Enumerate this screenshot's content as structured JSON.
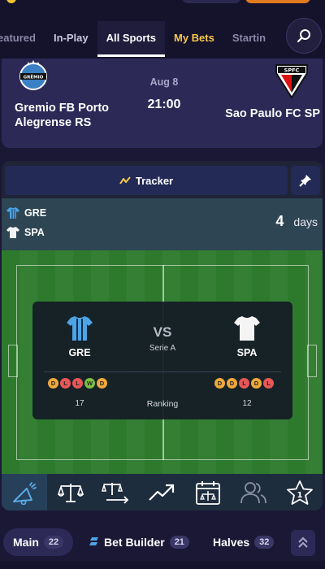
{
  "nav": {
    "tabs": [
      {
        "label": "eatured"
      },
      {
        "label": "In-Play"
      },
      {
        "label": "All Sports"
      },
      {
        "label": "My Bets"
      },
      {
        "label": "Startin"
      }
    ]
  },
  "match": {
    "home_team": "Gremio FB Porto Alegrense RS",
    "away_team": "Sao Paulo FC SP",
    "date": "Aug 8",
    "time": "21:00",
    "home_crest_text": "GRÊMIO",
    "away_crest_text": "SPFC"
  },
  "tracker": {
    "title": "Tracker",
    "home_code": "GRE",
    "away_code": "SPA",
    "days_value": "4",
    "days_label": "days",
    "vs_label": "VS",
    "league": "Serie A",
    "home_form": [
      "D",
      "L",
      "L",
      "W",
      "D"
    ],
    "away_form": [
      "D",
      "D",
      "L",
      "D",
      "L"
    ],
    "home_rank": "17",
    "away_rank": "12",
    "rank_label": "Ranking",
    "icons": [
      "alert-icon",
      "balance-icon",
      "balance-arrow-icon",
      "trend-icon",
      "calendar-icon",
      "players-icon",
      "star-one-icon"
    ]
  },
  "bottom": {
    "main_label": "Main",
    "main_count": "22",
    "bb_label": "Bet Builder",
    "bb_count": "21",
    "halves_label": "Halves",
    "halves_count": "32"
  },
  "colors": {
    "accent": "#f7c948",
    "form_draw": "#f0a83b",
    "form_loss": "#e85757",
    "form_win": "#7bc043"
  }
}
